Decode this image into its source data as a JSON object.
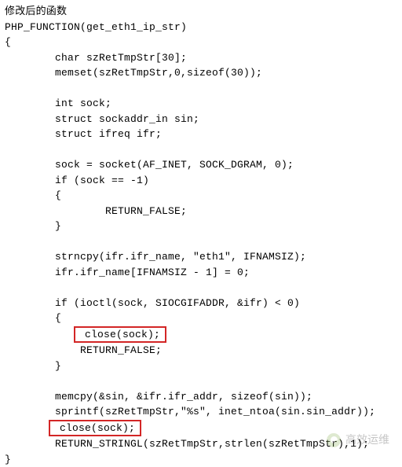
{
  "title_cn": "修改后的函数",
  "code": {
    "l01": "PHP_FUNCTION(get_eth1_ip_str)",
    "l02": "{",
    "l03": "        char szRetTmpStr[30];",
    "l04": "        memset(szRetTmpStr,0,sizeof(30));",
    "l05": "",
    "l06": "        int sock;",
    "l07": "        struct sockaddr_in sin;",
    "l08": "        struct ifreq ifr;",
    "l09": "",
    "l10": "        sock = socket(AF_INET, SOCK_DGRAM, 0);",
    "l11": "        if (sock == -1)",
    "l12": "        {",
    "l13": "                RETURN_FALSE;",
    "l14": "        }",
    "l15": "",
    "l16": "        strncpy(ifr.ifr_name, \"eth1\", IFNAMSIZ);",
    "l17": "        ifr.ifr_name[IFNAMSIZ - 1] = 0;",
    "l18": "",
    "l19": "        if (ioctl(sock, SIOCGIFADDR, &ifr) < 0)",
    "l20": "        {",
    "hl1": " close(sock);",
    "l22": "            RETURN_FALSE;",
    "l23": "        }",
    "l24": "",
    "l25": "        memcpy(&sin, &ifr.ifr_addr, sizeof(sin));",
    "l26": "        sprintf(szRetTmpStr,\"%s\", inet_ntoa(sin.sin_addr));",
    "hl2": " close(sock);",
    "l28": "        RETURN_STRINGL(szRetTmpStr,strlen(szRetTmpStr),1);",
    "l29": "}"
  },
  "highlight_indent1": "           ",
  "highlight_indent2": "       ",
  "watermark_text": "高效运维"
}
